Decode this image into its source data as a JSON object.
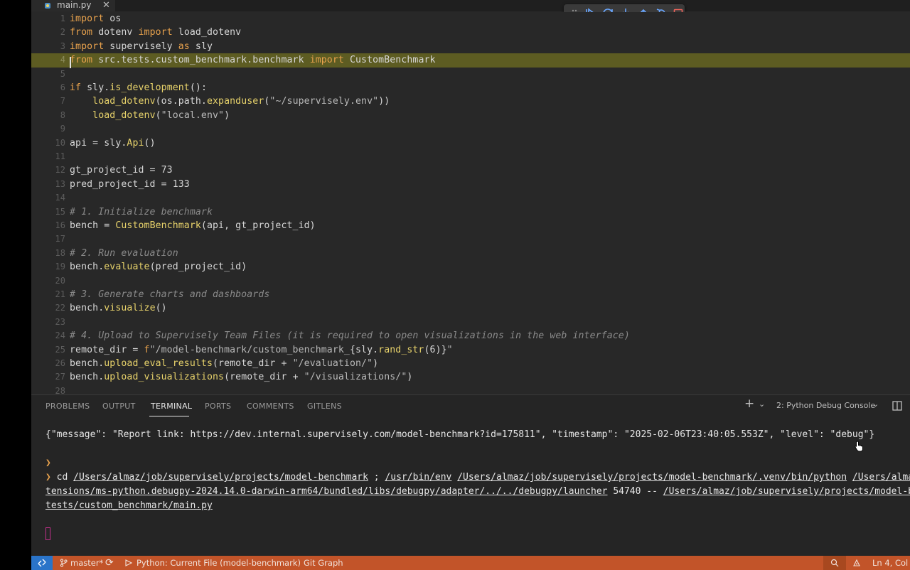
{
  "tab": {
    "filename": "main.py",
    "close": "✕"
  },
  "debug_toolbar": {
    "buttons": [
      "drag-handle-icon",
      "continue-icon",
      "step-over-icon",
      "step-into-icon",
      "step-out-icon",
      "restart-icon",
      "stop-icon"
    ]
  },
  "editor": {
    "breakpoint_line": "4",
    "lines": [
      {
        "n": "1"
      },
      {
        "n": "2"
      },
      {
        "n": "3"
      },
      {
        "n": "4"
      },
      {
        "n": "5"
      },
      {
        "n": "6"
      },
      {
        "n": "7"
      },
      {
        "n": "8"
      },
      {
        "n": "9"
      },
      {
        "n": "10"
      },
      {
        "n": "11"
      },
      {
        "n": "12"
      },
      {
        "n": "13"
      },
      {
        "n": "14"
      },
      {
        "n": "15"
      },
      {
        "n": "16"
      },
      {
        "n": "17"
      },
      {
        "n": "18"
      },
      {
        "n": "19"
      },
      {
        "n": "20"
      },
      {
        "n": "21"
      },
      {
        "n": "22"
      },
      {
        "n": "23"
      },
      {
        "n": "24"
      },
      {
        "n": "25"
      },
      {
        "n": "26"
      },
      {
        "n": "27"
      },
      {
        "n": "28"
      }
    ],
    "code": {
      "l1_kw": "import",
      "l1_rest": " os",
      "l2_kw1": "from",
      "l2_mid": " dotenv ",
      "l2_kw2": "import",
      "l2_rest": " load_dotenv",
      "l3_kw1": "import",
      "l3_mid": " supervisely ",
      "l3_kw2": "as",
      "l3_rest": " sly",
      "l4_kw1": "from",
      "l4_mid": " src.tests.custom_benchmark.benchmark ",
      "l4_kw2": "import",
      "l4_rest": " CustomBenchmark",
      "l6_kw": "if",
      "l6_a": " sly.",
      "l6_fn": "is_development",
      "l6_b": "():",
      "l7_indent": "    ",
      "l7_fn": "load_dotenv",
      "l7_a": "(os.path.",
      "l7_fn2": "expanduser",
      "l7_b": "(",
      "l7_str": "\"~/supervisely.env\"",
      "l7_c": "))",
      "l8_indent": "    ",
      "l8_fn": "load_dotenv",
      "l8_a": "(",
      "l8_str": "\"local.env\"",
      "l8_b": ")",
      "l10_a": "api = sly.",
      "l10_fn": "Api",
      "l10_b": "()",
      "l12_a": "gt_project_id = ",
      "l12_num": "73",
      "l13_a": "pred_project_id = ",
      "l13_num": "133",
      "l15_cm": "# 1. Initialize benchmark",
      "l16_a": "bench = ",
      "l16_fn": "CustomBenchmark",
      "l16_b": "(api, gt_project_id)",
      "l18_cm": "# 2. Run evaluation",
      "l19_a": "bench.",
      "l19_fn": "evaluate",
      "l19_b": "(pred_project_id)",
      "l21_cm": "# 3. Generate charts and dashboards",
      "l22_a": "bench.",
      "l22_fn": "visualize",
      "l22_b": "()",
      "l24_cm": "# 4. Upload to Supervisely Team Files (it is required to open visualizations in the web interface)",
      "l25_a": "remote_dir = ",
      "l25_kw": "f",
      "l25_str": "\"/model-benchmark/custom_benchmark_",
      "l25_b": "{sly.",
      "l25_fn": "rand_str",
      "l25_c": "(6)}",
      "l25_str2": "\"",
      "l26_a": "bench.",
      "l26_fn": "upload_eval_results",
      "l26_b": "(remote_dir + ",
      "l26_str": "\"/evaluation/\"",
      "l26_c": ")",
      "l27_a": "bench.",
      "l27_fn": "upload_visualizations",
      "l27_b": "(remote_dir + ",
      "l27_str": "\"/visualizations/\"",
      "l27_c": ")"
    }
  },
  "panel": {
    "tabs": [
      "PROBLEMS",
      "OUTPUT",
      "TERMINAL",
      "PORTS",
      "COMMENTS",
      "GITLENS"
    ],
    "active_tab": "TERMINAL",
    "add_label": "+",
    "dropdown_chevron": "⌄",
    "console_selector": "2: Python Debug Console",
    "terminal": {
      "line1": "{\"message\": \"Report link: https://dev.internal.supervisely.com/model-benchmark?id=175811\", \"timestamp\": \"2025-02-06T23:40:05.553Z\", \"level\": \"debug\"}",
      "prompt1": "❯",
      "prompt2": "❯",
      "cmd_cd": " cd ",
      "cmd_path1": "/Users/almaz/job/supervisely/projects/model-benchmark",
      "cmd_sep": " ; ",
      "cmd_env": "/usr/bin/env",
      "cmd_sp": " ",
      "cmd_python": "/Users/almaz/job/supervisely/projects/model-benchmark/.venv/bin/python",
      "cmd_sp2": " ",
      "cmd_ext": "/Users/almaz",
      "line3_a": "tensions/ms-python.debugpy-2024.14.0-darwin-arm64/bundled/libs/debugpy/adapter/../../debugpy/launcher",
      "line3_b": " 54740 -- ",
      "line3_c": "/Users/almaz/job/supervisely/projects/model-ben",
      "line4": "tests/custom_benchmark/main.py"
    }
  },
  "statusbar": {
    "branch": "master*",
    "sync_icon": "⟳",
    "python_env": "Python: Current File (model-benchmark)",
    "git_graph": "Git Graph",
    "position": "Ln 4, Col"
  }
}
